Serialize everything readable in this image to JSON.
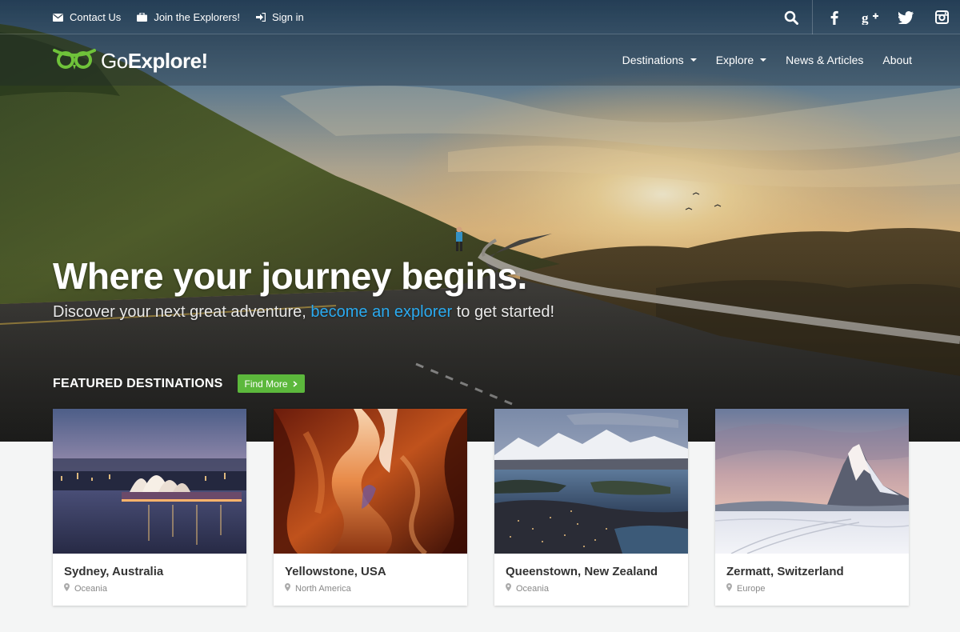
{
  "topbar": {
    "links": [
      {
        "label": "Contact Us",
        "icon": "envelope-icon"
      },
      {
        "label": "Join the Explorers!",
        "icon": "briefcase-icon"
      },
      {
        "label": "Sign in",
        "icon": "sign-in-icon"
      }
    ],
    "social_icons": [
      "search-icon",
      "facebook-icon",
      "google-plus-icon",
      "twitter-icon",
      "instagram-icon"
    ]
  },
  "brand": {
    "part1": "Go",
    "part2": "Explore!",
    "logo_icon": "owl-eyes-icon"
  },
  "nav": {
    "items": [
      {
        "label": "Destinations",
        "dropdown": true
      },
      {
        "label": "Explore",
        "dropdown": true
      },
      {
        "label": "News & Articles",
        "dropdown": false
      },
      {
        "label": "About",
        "dropdown": false
      }
    ]
  },
  "hero": {
    "headline": "Where your journey begins.",
    "sub_before": "Discover your next great adventure, ",
    "sub_link": "become an explorer",
    "sub_after": " to get started!"
  },
  "featured": {
    "title": "FEATURED DESTINATIONS",
    "button_label": "Find More",
    "button_icon": "chevron-right-icon"
  },
  "destinations": [
    {
      "name": "Sydney, Australia",
      "region": "Oceania"
    },
    {
      "name": "Yellowstone, USA",
      "region": "North America"
    },
    {
      "name": "Queenstown, New Zealand",
      "region": "Oceania"
    },
    {
      "name": "Zermatt, Switzerland",
      "region": "Europe"
    }
  ],
  "colors": {
    "accent_green": "#5cb83c",
    "link_blue": "#2aaaf0",
    "logo_green": "#6fc23a"
  }
}
